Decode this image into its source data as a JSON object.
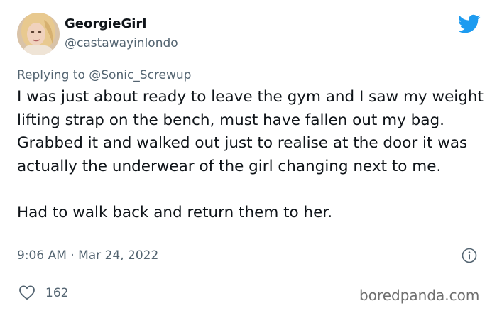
{
  "author": {
    "display_name": "GeorgieGirl",
    "handle": "@castawayinlondo"
  },
  "reply": {
    "prefix": "Replying to ",
    "mention": "@Sonic_Screwup"
  },
  "tweet": {
    "paragraphs": [
      "I was just about ready to leave the gym and I saw my weight lifting strap on the bench, must have fallen out my bag. Grabbed it and walked out just to realise at the door it was actually the underwear of the girl changing next to me.",
      "Had to walk back and return them to her."
    ],
    "timestamp": "9:06 AM · Mar 24, 2022"
  },
  "stats": {
    "likes": "162"
  },
  "watermark": "boredpanda.com",
  "icons": {
    "brand": "twitter-bird-icon",
    "info": "info-icon",
    "like": "heart-icon"
  },
  "colors": {
    "brand": "#1d9bf0",
    "secondary_text": "#536471",
    "primary_text": "#0f1419",
    "divider": "#cfd9de"
  }
}
